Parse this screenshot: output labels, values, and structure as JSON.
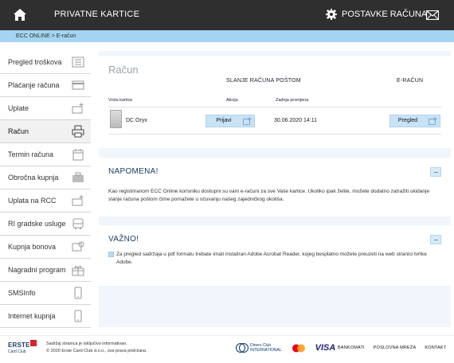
{
  "topbar": {
    "title": "PRIVATNE KARTICE",
    "settings_label": "POSTAVKE RAČUNA"
  },
  "breadcrumb": "ECC ONLINE > E-račun",
  "sidebar": {
    "items": [
      {
        "label": "Pregled troškova",
        "icon": "list-icon"
      },
      {
        "label": "Plaćanje računa",
        "icon": "card-icon"
      },
      {
        "label": "Uplate",
        "icon": "card-plus-icon"
      },
      {
        "label": "Račun",
        "icon": "printer-icon",
        "active": true
      },
      {
        "label": "Termin računa",
        "icon": "calendar-icon"
      },
      {
        "label": "Obročna kupnja",
        "icon": "briefcase-icon"
      },
      {
        "label": "Uplata na RCC",
        "icon": "card-plus-icon"
      },
      {
        "label": "RI gradske usluge",
        "icon": "bus-icon"
      },
      {
        "label": "Kupnja bonova",
        "icon": "voucher-icon"
      },
      {
        "label": "Nagradni program",
        "icon": "gift-icon"
      },
      {
        "label": "SMSInfo",
        "icon": "phone-icon"
      },
      {
        "label": "Internet kupnja",
        "icon": "phone-icon"
      }
    ]
  },
  "racun": {
    "title": "Račun",
    "col_slanje": "SLANJE RAČUNA POŠTOM",
    "col_eracun": "E-RAČUN",
    "hdr_vrsta": "Vrsta kartice",
    "hdr_akcija": "Akcija",
    "hdr_zadnja": "Zadnja promjena",
    "card_name": "DC Oryx",
    "prijavi_label": "Prijavi",
    "date": "30.06.2020 14:11",
    "pregled_label": "Pregled"
  },
  "napomena": {
    "title": "NAPOMENA!",
    "text": "Kao registriranom ECC Online korisniku dostupni su vam e-računi za sve Vaše kartice. Ukoliko ipak želite, možete dodatno zatražiti ukidanje slanje računa poštom čime pomažete u očuvanju našeg zajedničkog okoliša."
  },
  "vazno": {
    "title": "VAŽNO!",
    "text": "Za pregled sadržaja u pdf formatu trebate imati instaliran Adobe Acrobat Reader, kojeg besplatno možete preuzeti na web stranici tvrtke Adobe."
  },
  "footer": {
    "brand": "ERSTE",
    "brand_sub": "Card Club",
    "line1": "Sadržaj stranica je isključivo informativan.",
    "line2": "© 2020 Erste Card Club d.o.o., sva prava pridržana.",
    "diners": "Diners Club",
    "diners_sub": "INTERNATIONAL",
    "visa": "VISA",
    "links": [
      "BANKOMATI",
      "POSLOVNA MREŽA",
      "KONTAKT"
    ]
  },
  "colors": {
    "topbar": "#2f2f2f",
    "breadcrumb": "#a4d4ef",
    "button": "#c8e3f4",
    "main_bg": "#f0f6fb",
    "title_blue": "#1a3e6a"
  }
}
